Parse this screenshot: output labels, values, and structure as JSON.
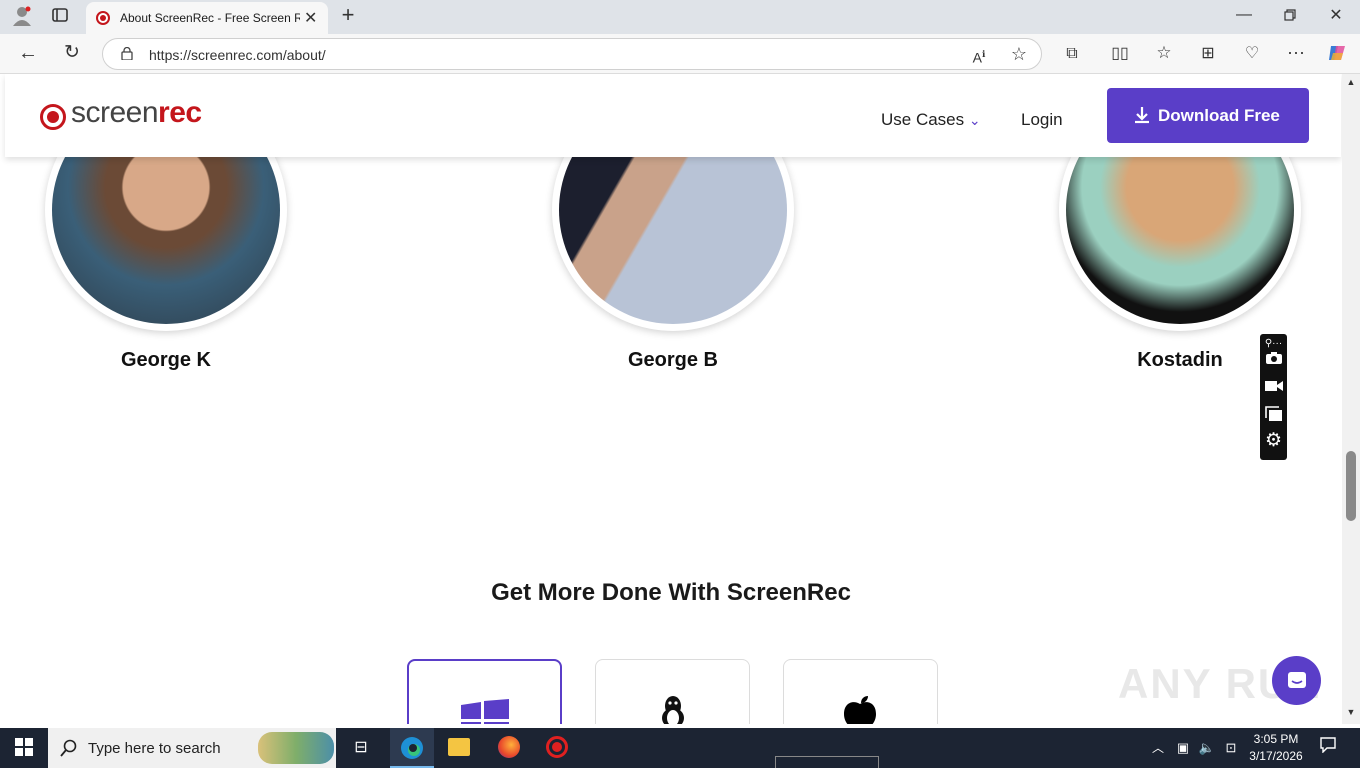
{
  "browser": {
    "tab_title": "About ScreenRec - Free Screen Re",
    "url": "https://screenrec.com/about/"
  },
  "site": {
    "logo_prefix": "screen",
    "logo_suffix": "rec",
    "nav_use_cases": "Use Cases",
    "nav_login": "Login",
    "download_label": "Download Free"
  },
  "team": [
    {
      "name": "George K"
    },
    {
      "name": "George B"
    },
    {
      "name": "Kostadin"
    }
  ],
  "section_title": "Get More Done With ScreenRec",
  "os_options": [
    "windows-icon",
    "linux-icon",
    "apple-icon"
  ],
  "watermark": "ANY RUN",
  "taskbar": {
    "search_placeholder": "Type here to search",
    "time": "3:05 PM",
    "date": "3/17/2026"
  },
  "colors": {
    "brand_red": "#c4161c",
    "accent_purple": "#5a3ec8"
  }
}
